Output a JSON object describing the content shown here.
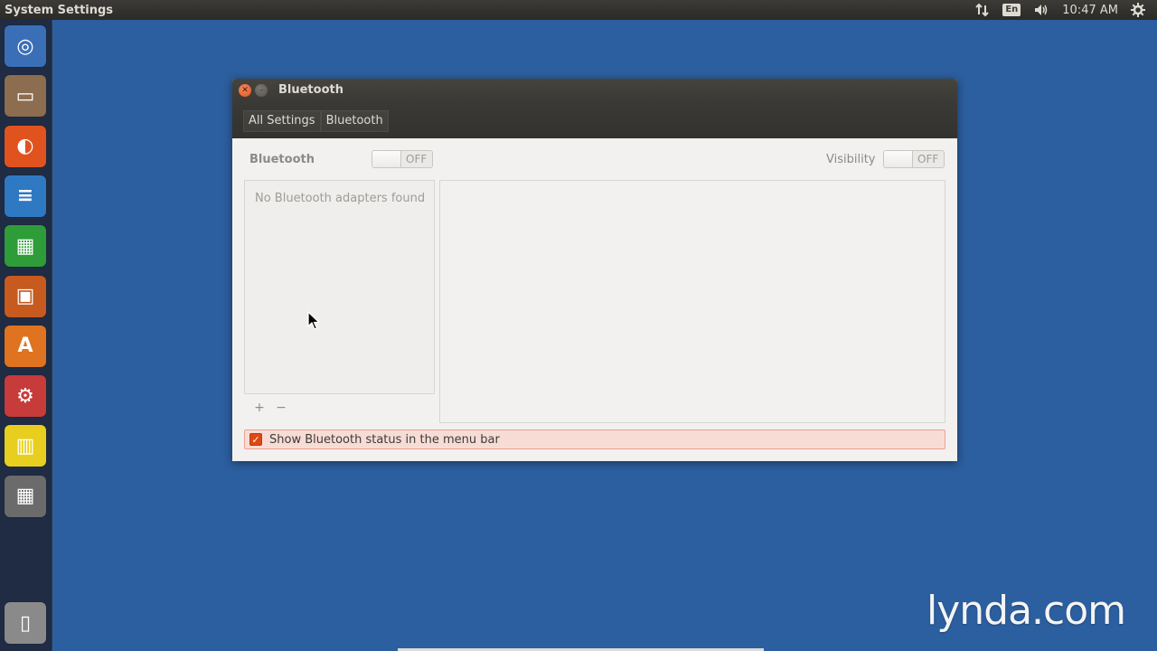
{
  "top_panel": {
    "app_title": "System Settings",
    "language": "En",
    "clock": "10:47 AM",
    "icons": [
      "network-icon",
      "volume-icon",
      "gear-icon"
    ]
  },
  "launcher": {
    "items": [
      {
        "name": "dash-home",
        "glyph": "◎",
        "color": "#3a6fb8"
      },
      {
        "name": "files",
        "glyph": "▭",
        "color": "#8c6d4f"
      },
      {
        "name": "firefox",
        "glyph": "◐",
        "color": "#e0531f"
      },
      {
        "name": "libreoffice-writer",
        "glyph": "≡",
        "color": "#2f79c3"
      },
      {
        "name": "libreoffice-calc",
        "glyph": "▦",
        "color": "#2f9c3a"
      },
      {
        "name": "libreoffice-impress",
        "glyph": "▣",
        "color": "#c75a1f"
      },
      {
        "name": "ubuntu-software-center",
        "glyph": "A",
        "color": "#e0731f"
      },
      {
        "name": "system-settings",
        "glyph": "⚙",
        "color": "#c73b3b"
      },
      {
        "name": "lens-app",
        "glyph": "▥",
        "color": "#e8cf1f"
      },
      {
        "name": "calculator",
        "glyph": "▦",
        "color": "#6b6b6b"
      },
      {
        "name": "trash",
        "glyph": "▯",
        "color": "#8a8a8a"
      }
    ]
  },
  "window": {
    "title": "Bluetooth",
    "breadcrumbs": [
      "All Settings",
      "Bluetooth"
    ],
    "bluetooth_label": "Bluetooth",
    "bluetooth_switch": "OFF",
    "visibility_label": "Visibility",
    "visibility_switch": "OFF",
    "adapters_empty": "No Bluetooth adapters found",
    "add_button": "+",
    "remove_button": "−",
    "show_status_label": "Show Bluetooth status in the menu bar",
    "show_status_checked": true
  },
  "watermark": "lynda.com"
}
